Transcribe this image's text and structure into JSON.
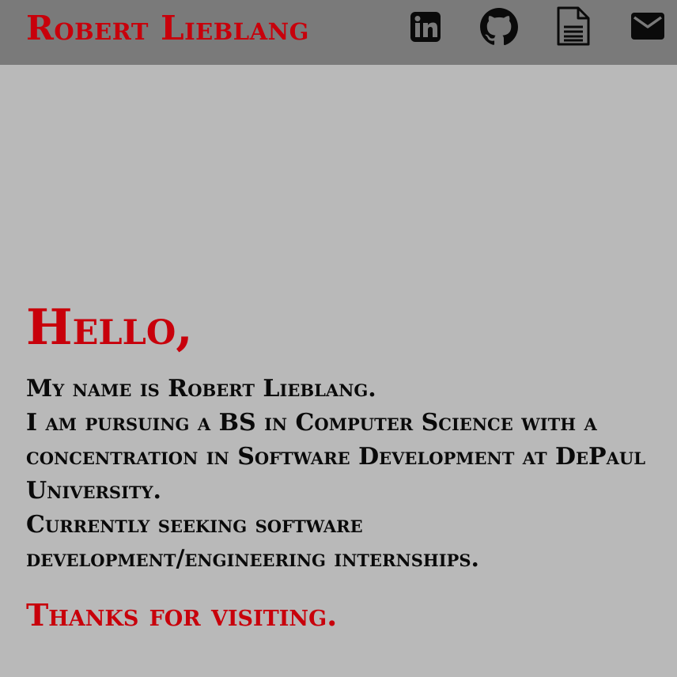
{
  "header": {
    "site_name": "Robert Lieblang",
    "icons": [
      {
        "name": "linkedin-icon"
      },
      {
        "name": "github-icon"
      },
      {
        "name": "resume-icon"
      },
      {
        "name": "mail-icon"
      }
    ]
  },
  "main": {
    "greeting": "Hello,",
    "intro_lines": [
      "My name is Robert Lieblang.",
      "I am pursuing a BS in Computer Science with a concentration in Software Development at DePaul University.",
      "Currently seeking software development/engineering internships."
    ],
    "thanks": "Thanks for visiting."
  },
  "colors": {
    "accent": "#c8000b",
    "header_bg": "#7a7a7a",
    "page_bg": "#b9b9b9",
    "text": "#0a0a0a"
  }
}
